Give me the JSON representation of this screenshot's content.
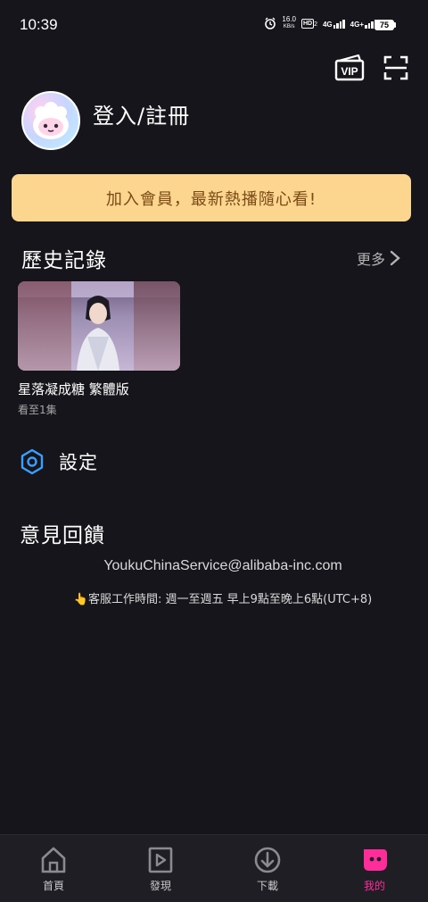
{
  "status_bar": {
    "time": "10:39",
    "net_speed_value": "16.0",
    "net_speed_unit": "KB/s",
    "hd_label": "HD",
    "hd_sub": "2",
    "network1": "4G",
    "network2": "4G+",
    "battery": "75"
  },
  "header": {
    "vip_icon_label": "VIP",
    "login_label": "登入/註冊"
  },
  "banner": {
    "text": "加入會員，最新熱播隨心看!"
  },
  "history": {
    "title": "歷史記錄",
    "more_label": "更多",
    "items": [
      {
        "title": "星落凝成糖 繁體版",
        "progress": "看至1集"
      }
    ]
  },
  "settings": {
    "label": "設定"
  },
  "feedback": {
    "title": "意見回饋",
    "email": "YoukuChinaService@alibaba-inc.com",
    "hours": "👆客服工作時間: 週一至週五 早上9點至晚上6點(UTC+8)"
  },
  "bottom_nav": {
    "items": [
      {
        "label": "首頁",
        "icon": "home-icon"
      },
      {
        "label": "發現",
        "icon": "discover-icon"
      },
      {
        "label": "下載",
        "icon": "download-icon"
      },
      {
        "label": "我的",
        "icon": "profile-icon",
        "active": true
      }
    ]
  },
  "colors": {
    "background": "#16151b",
    "banner": "#fcd58f",
    "banner_text": "#7b4a16",
    "accent": "#ff2d9a",
    "settings_icon": "#3aa0ff"
  }
}
